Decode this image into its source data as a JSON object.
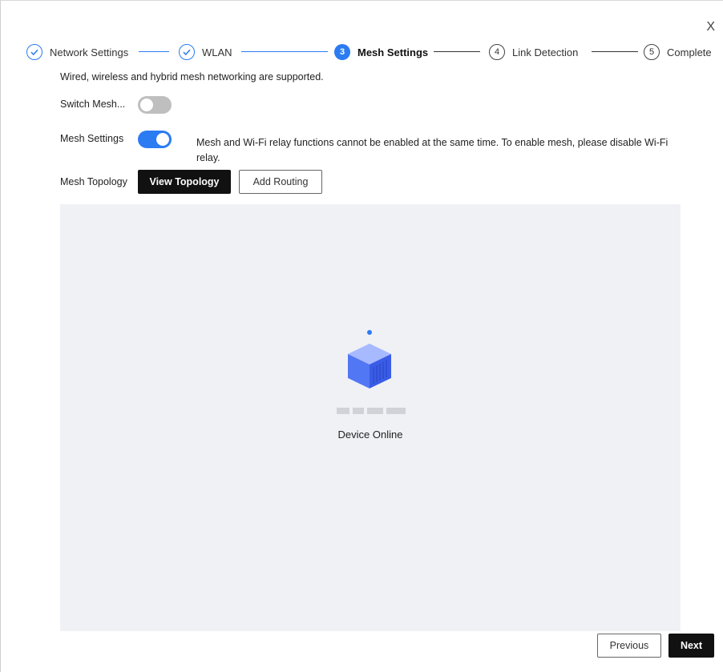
{
  "dialog": {
    "close_label": "X"
  },
  "stepper": {
    "steps": [
      {
        "number": "1",
        "label": "Network Settings",
        "state": "done"
      },
      {
        "number": "2",
        "label": "WLAN",
        "state": "done"
      },
      {
        "number": "3",
        "label": "Mesh Settings",
        "state": "active"
      },
      {
        "number": "4",
        "label": "Link Detection",
        "state": "todo"
      },
      {
        "number": "5",
        "label": "Complete",
        "state": "todo"
      }
    ]
  },
  "description": "Wired, wireless and hybrid mesh networking are supported.",
  "switch_mesh": {
    "label": "Switch Mesh...",
    "enabled": false
  },
  "mesh_settings": {
    "label": "Mesh Settings",
    "enabled": true,
    "hint": "Mesh and Wi-Fi relay functions cannot be enabled at the same time. To enable mesh, please disable Wi-Fi relay."
  },
  "mesh_topology": {
    "label": "Mesh Topology",
    "view_topology_label": "View Topology",
    "add_routing_label": "Add Routing"
  },
  "topology": {
    "device": {
      "status": "Device Online"
    }
  },
  "footer": {
    "previous_label": "Previous",
    "next_label": "Next"
  },
  "colors": {
    "accent": "#2b7bf3",
    "primary_button": "#111111",
    "canvas_bg": "#f0f1f5"
  }
}
